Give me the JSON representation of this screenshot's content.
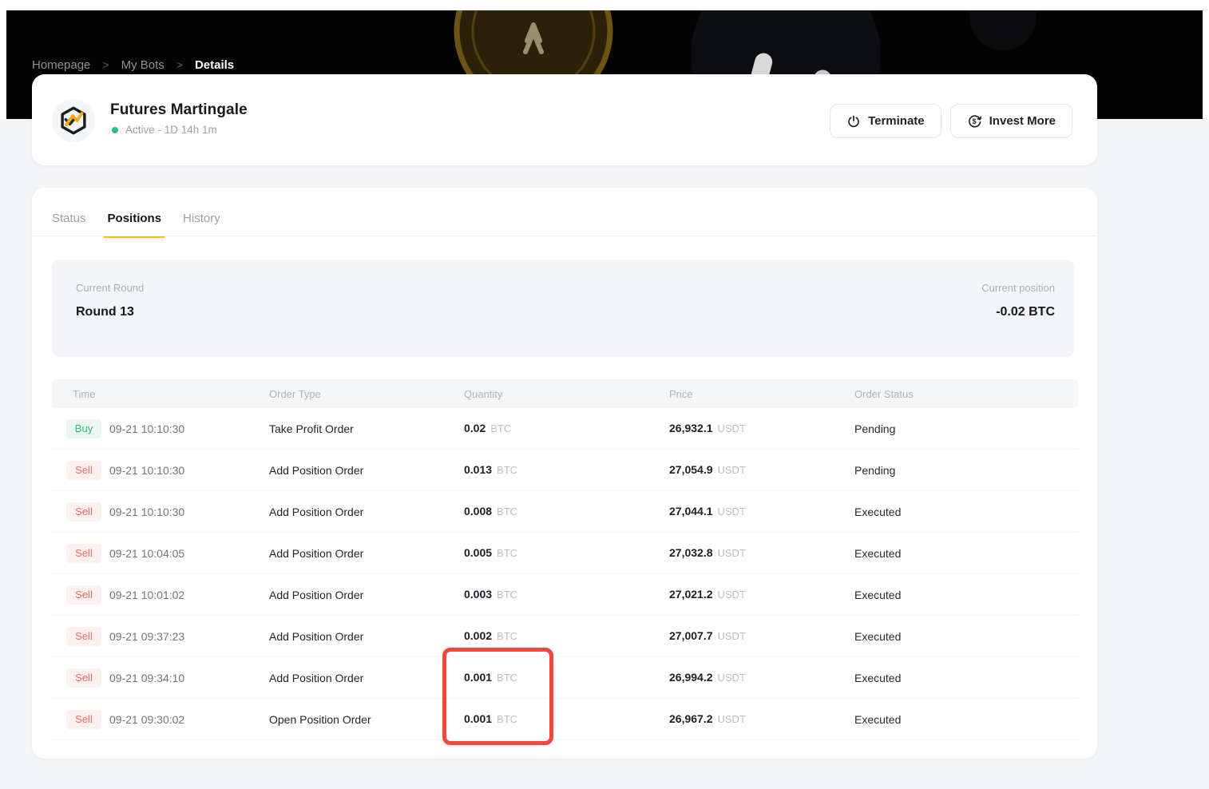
{
  "colors": {
    "accent_yellow": "#fcbe14",
    "buy_green": "#35b97c",
    "sell_red": "#ee6d64",
    "status_green": "#2ebd85",
    "highlight_red": "#f4473c"
  },
  "breadcrumb": {
    "separator": ">",
    "items": [
      "Homepage",
      "My Bots",
      "Details"
    ]
  },
  "header_card": {
    "bot_icon": "martingale-hexagon-icon",
    "title": "Futures Martingale",
    "status_text": "Active - 1D 14h 1m",
    "buttons": [
      {
        "icon": "power-icon",
        "label": "Terminate"
      },
      {
        "icon": "invest-dollar-icon",
        "label": "Invest More"
      }
    ]
  },
  "tabs": {
    "items": [
      {
        "label": "Status",
        "active": "false"
      },
      {
        "label": "Positions",
        "active": "true"
      },
      {
        "label": "History",
        "active": "false"
      }
    ]
  },
  "summary": {
    "round_label": "Current Round",
    "round_value": "Round 13",
    "position_label": "Current position",
    "position_value": "-0.02 BTC"
  },
  "table": {
    "columns": [
      "Time",
      "Order Type",
      "Quantity",
      "Price",
      "Order Status"
    ],
    "rows": [
      {
        "side": "Buy",
        "time": "09-21 10:10:30",
        "order_type": "Take Profit Order",
        "quantity": "0.02",
        "quantity_unit": "BTC",
        "price": "26,932.1",
        "price_unit": "USDT",
        "status": "Pending"
      },
      {
        "side": "Sell",
        "time": "09-21 10:10:30",
        "order_type": "Add Position Order",
        "quantity": "0.013",
        "quantity_unit": "BTC",
        "price": "27,054.9",
        "price_unit": "USDT",
        "status": "Pending"
      },
      {
        "side": "Sell",
        "time": "09-21 10:10:30",
        "order_type": "Add Position Order",
        "quantity": "0.008",
        "quantity_unit": "BTC",
        "price": "27,044.1",
        "price_unit": "USDT",
        "status": "Executed"
      },
      {
        "side": "Sell",
        "time": "09-21 10:04:05",
        "order_type": "Add Position Order",
        "quantity": "0.005",
        "quantity_unit": "BTC",
        "price": "27,032.8",
        "price_unit": "USDT",
        "status": "Executed"
      },
      {
        "side": "Sell",
        "time": "09-21 10:01:02",
        "order_type": "Add Position Order",
        "quantity": "0.003",
        "quantity_unit": "BTC",
        "price": "27,021.2",
        "price_unit": "USDT",
        "status": "Executed"
      },
      {
        "side": "Sell",
        "time": "09-21 09:37:23",
        "order_type": "Add Position Order",
        "quantity": "0.002",
        "quantity_unit": "BTC",
        "price": "27,007.7",
        "price_unit": "USDT",
        "status": "Executed"
      },
      {
        "side": "Sell",
        "time": "09-21 09:34:10",
        "order_type": "Add Position Order",
        "quantity": "0.001",
        "quantity_unit": "BTC",
        "price": "26,994.2",
        "price_unit": "USDT",
        "status": "Executed"
      },
      {
        "side": "Sell",
        "time": "09-21 09:30:02",
        "order_type": "Open Position Order",
        "quantity": "0.001",
        "quantity_unit": "BTC",
        "price": "26,967.2",
        "price_unit": "USDT",
        "status": "Executed"
      }
    ]
  },
  "highlight": {
    "color": "#f4473c"
  }
}
